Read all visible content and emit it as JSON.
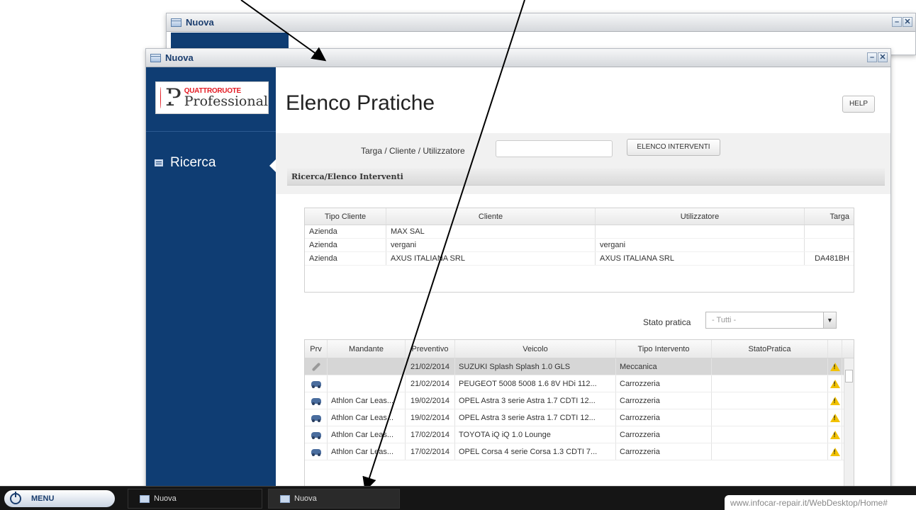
{
  "back_window": {
    "title": "Nuova"
  },
  "window": {
    "title": "Nuova",
    "min_label": "–",
    "close_label": "✕"
  },
  "logo": {
    "letter_q": "Q",
    "letter_p": "P",
    "brand_top": "QUATTRORUOTE",
    "brand_bottom": "Professional"
  },
  "sidebar": {
    "items": [
      {
        "label": "Ricerca"
      }
    ]
  },
  "header": {
    "title": "Elenco Pratiche",
    "help_label": "HELP"
  },
  "search": {
    "label": "Targa / Cliente / Utilizzatore",
    "value": "",
    "button_label": "ELENCO INTERVENTI"
  },
  "section": {
    "title": "Ricerca/Elenco Interventi"
  },
  "clients_table": {
    "columns": [
      "Tipo Cliente",
      "Cliente",
      "Utilizzatore",
      "Targa"
    ],
    "rows": [
      [
        "Azienda",
        "MAX SAL",
        "",
        ""
      ],
      [
        "Azienda",
        "vergani",
        "vergani",
        ""
      ],
      [
        "Azienda",
        "AXUS ITALIANA SRL",
        "AXUS ITALIANA SRL",
        "DA481BH"
      ]
    ]
  },
  "stato": {
    "label": "Stato pratica",
    "value": "- Tutti -"
  },
  "practices_table": {
    "columns": [
      "Prv",
      "Mandante",
      "Preventivo",
      "Veicolo",
      "Tipo Intervento",
      "StatoPratica"
    ],
    "rows": [
      {
        "icon": "wrench-icon",
        "mandante": "",
        "preventivo": "21/02/2014",
        "veicolo": "SUZUKI Splash Splash 1.0 GLS",
        "tipo": "Meccanica",
        "stato": ""
      },
      {
        "icon": "car-icon",
        "mandante": "",
        "preventivo": "21/02/2014",
        "veicolo": "PEUGEOT 5008 5008 1.6 8V HDi 112...",
        "tipo": "Carrozzeria",
        "stato": ""
      },
      {
        "icon": "car-icon",
        "mandante": "Athlon Car Leas...",
        "preventivo": "19/02/2014",
        "veicolo": "OPEL Astra 3 serie Astra 1.7 CDTI 12...",
        "tipo": "Carrozzeria",
        "stato": ""
      },
      {
        "icon": "car-icon",
        "mandante": "Athlon Car Leas...",
        "preventivo": "19/02/2014",
        "veicolo": "OPEL Astra 3 serie Astra 1.7 CDTI 12...",
        "tipo": "Carrozzeria",
        "stato": ""
      },
      {
        "icon": "car-icon",
        "mandante": "Athlon Car Leas...",
        "preventivo": "17/02/2014",
        "veicolo": "TOYOTA iQ iQ 1.0 Lounge",
        "tipo": "Carrozzeria",
        "stato": ""
      },
      {
        "icon": "car-icon",
        "mandante": "Athlon Car Leas...",
        "preventivo": "17/02/2014",
        "veicolo": "OPEL Corsa 4 serie Corsa 1.3 CDTI 7...",
        "tipo": "Carrozzeria",
        "stato": ""
      }
    ]
  },
  "taskbar": {
    "menu_label": "MENU",
    "items": [
      "Nuova",
      "Nuova"
    ],
    "url": "www.infocar-repair.it/WebDesktop/Home#"
  }
}
